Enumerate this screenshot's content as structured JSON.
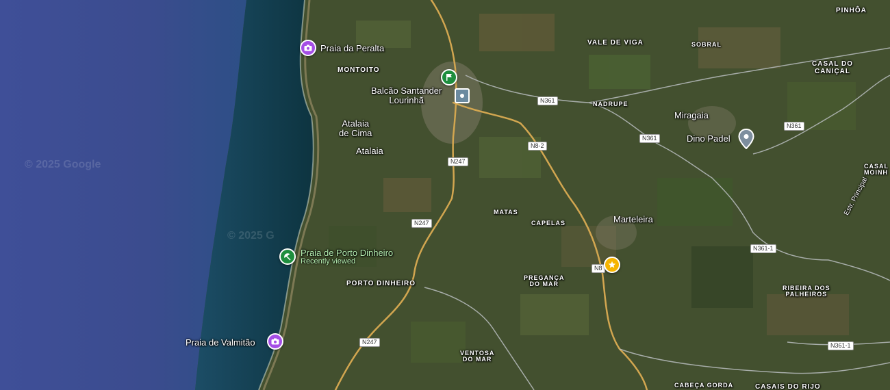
{
  "map": {
    "watermarks": [
      "© 2025 Google",
      "© 2025 G"
    ],
    "colors": {
      "ocean": "#3e4f95",
      "coast_water": "#12394a",
      "land": "#414d2d",
      "road": "#d2a650",
      "poi_purple": "#a54ee6",
      "poi_green": "#1e8e3e",
      "poi_yellow": "#f5b400",
      "poi_gray": "#7d8e9e"
    },
    "places": {
      "montoito": "MONTOITO",
      "vale_de_viga": "VALE DE VIGA",
      "sobral": "SOBRAL",
      "pinhoa": "PINHÔA",
      "casal_do_canical": "CASAL DO\nCANIÇAL",
      "nadrupe": "NADRUPE",
      "miragaia": "Miragaia",
      "atalaia_de_cima": "Atalaia\nde Cima",
      "atalaia": "Atalaia",
      "matas": "MATAS",
      "capelas": "CAPELAS",
      "marteleira": "Marteleira",
      "casal_moinho": "CASAL\nMOINH",
      "porto_dinheiro": "PORTO DINHEIRO",
      "preganca_do_mar": "PREGANÇA\nDO MAR",
      "ribeira_dos_palheiros": "RIBEIRA DOS\nPALHEIROS",
      "ventosa_do_mar": "VENTOSA\nDO MAR",
      "cabeca_gorda": "CABEÇA GORDA",
      "casais_do_rijo": "CASAIS DO RIJO",
      "estr_principal": "Estr. Principal"
    },
    "pois": {
      "praia_peralta": "Praia da Peralta",
      "balcao_santander": "Balcão Santander\nLourinhã",
      "praia_porto_dinheiro": "Praia de Porto Dinheiro",
      "recently_viewed": "Recently viewed",
      "praia_valmitao": "Praia de Valmitão",
      "dino_padel": "Dino Padel"
    },
    "roads": {
      "n361_a": "N361",
      "n361_b": "N361",
      "n361_c": "N361",
      "n8_2": "N8-2",
      "n247_a": "N247",
      "n247_b": "N247",
      "n247_c": "N247",
      "n8": "N8",
      "n361_1_a": "N361-1",
      "n361_1_b": "N361-1"
    }
  }
}
